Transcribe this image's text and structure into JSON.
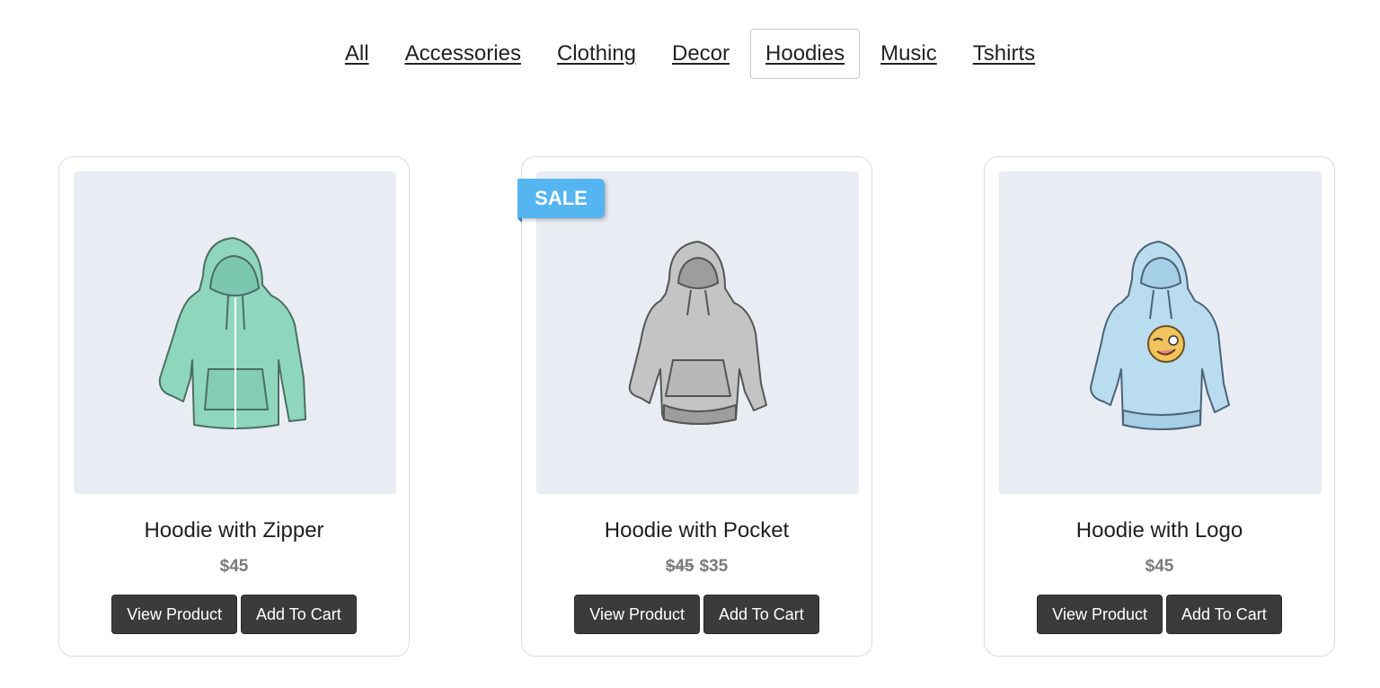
{
  "filters": [
    {
      "label": "All",
      "active": false
    },
    {
      "label": "Accessories",
      "active": false
    },
    {
      "label": "Clothing",
      "active": false
    },
    {
      "label": "Decor",
      "active": false
    },
    {
      "label": "Hoodies",
      "active": true
    },
    {
      "label": "Music",
      "active": false
    },
    {
      "label": "Tshirts",
      "active": false
    }
  ],
  "products": [
    {
      "title": "Hoodie with Zipper",
      "price": "$45",
      "old_price": "",
      "sale_badge": "",
      "image_icon": "zip-hoodie-image",
      "color": "#8fd6bf",
      "view_label": "View Product",
      "cart_label": "Add To Cart"
    },
    {
      "title": "Hoodie with Pocket",
      "price": "$35",
      "old_price": "$45",
      "sale_badge": "SALE",
      "image_icon": "pocket-hoodie-image",
      "color": "#c4c4c4",
      "view_label": "View Product",
      "cart_label": "Add To Cart"
    },
    {
      "title": "Hoodie with Logo",
      "price": "$45",
      "old_price": "",
      "sale_badge": "",
      "image_icon": "logo-hoodie-image",
      "color": "#b9dcef",
      "view_label": "View Product",
      "cart_label": "Add To Cart"
    }
  ],
  "colors": {
    "sale_badge": "#55b5f0",
    "button": "#3b3b3b",
    "image_bg": "#e9edf3"
  }
}
